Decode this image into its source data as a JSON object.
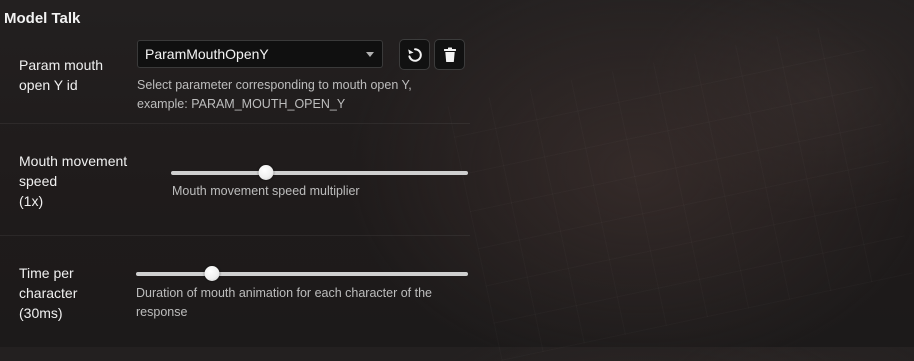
{
  "section": {
    "title": "Model Talk"
  },
  "mouth_param": {
    "label_line1": "Param mouth",
    "label_line2": "open Y id",
    "selected_value": "ParamMouthOpenY",
    "hint_line1": "Select parameter corresponding to mouth open Y,",
    "hint_line2": "example: PARAM_MOUTH_OPEN_Y",
    "reset_icon": "reset-icon",
    "delete_icon": "trash-icon"
  },
  "mouth_speed": {
    "label_line1": "Mouth movement",
    "label_line2": "speed",
    "label_line3": "(1x)",
    "hint": "Mouth movement speed multiplier",
    "slider_fraction": 0.32
  },
  "time_per_char": {
    "label_line1": "Time per",
    "label_line2": "character",
    "label_line3": "(30ms)",
    "hint_line1": "Duration of mouth animation for each character of the",
    "hint_line2": "response",
    "slider_fraction": 0.23
  },
  "colors": {
    "background": "#1f1c1c",
    "control_bg": "#101010",
    "track": "#cfcfcf",
    "hint_text": "#bdbdbd"
  }
}
